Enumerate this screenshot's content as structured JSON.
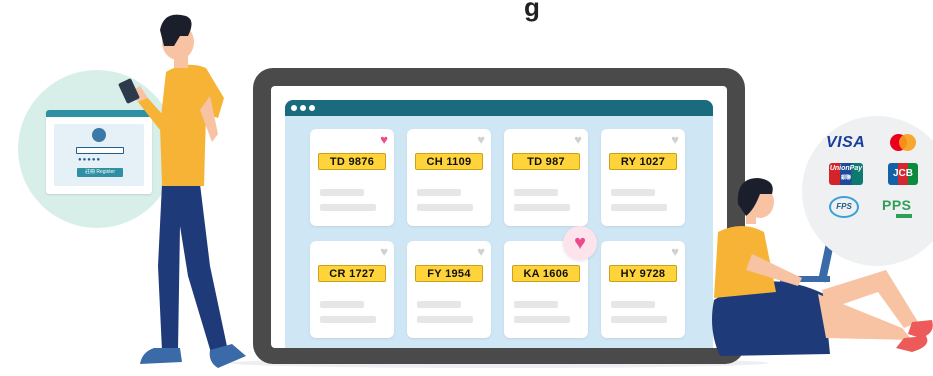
{
  "heading": {
    "partial_text": "g"
  },
  "login_panel": {
    "password_mask": "●●●●●",
    "button_label": "註冊 Register"
  },
  "listing": {
    "cards": [
      {
        "plate": "TD 9876",
        "favorited": true
      },
      {
        "plate": "CH 1109",
        "favorited": false
      },
      {
        "plate": "TD 987",
        "favorited": false
      },
      {
        "plate": "RY 1027",
        "favorited": false
      },
      {
        "plate": "CR 1727",
        "favorited": false
      },
      {
        "plate": "FY 1954",
        "favorited": false
      },
      {
        "plate": "KA 1606",
        "favorited": false
      },
      {
        "plate": "HY 9728",
        "favorited": false
      }
    ],
    "heart_icon": "heart-icon"
  },
  "payment_methods": {
    "visa": "VISA",
    "unionpay": "UnionPay",
    "unionpay_sub": "銀聯",
    "jcb": "JCB",
    "fps": "FPS",
    "pps": "PPS"
  },
  "colors": {
    "plate_yellow": "#ffd43b",
    "browser_bar": "#1a6b7d",
    "heart_active": "#ec4a8c",
    "shirt_yellow": "#f6b336",
    "pants_navy": "#1f3a78"
  }
}
